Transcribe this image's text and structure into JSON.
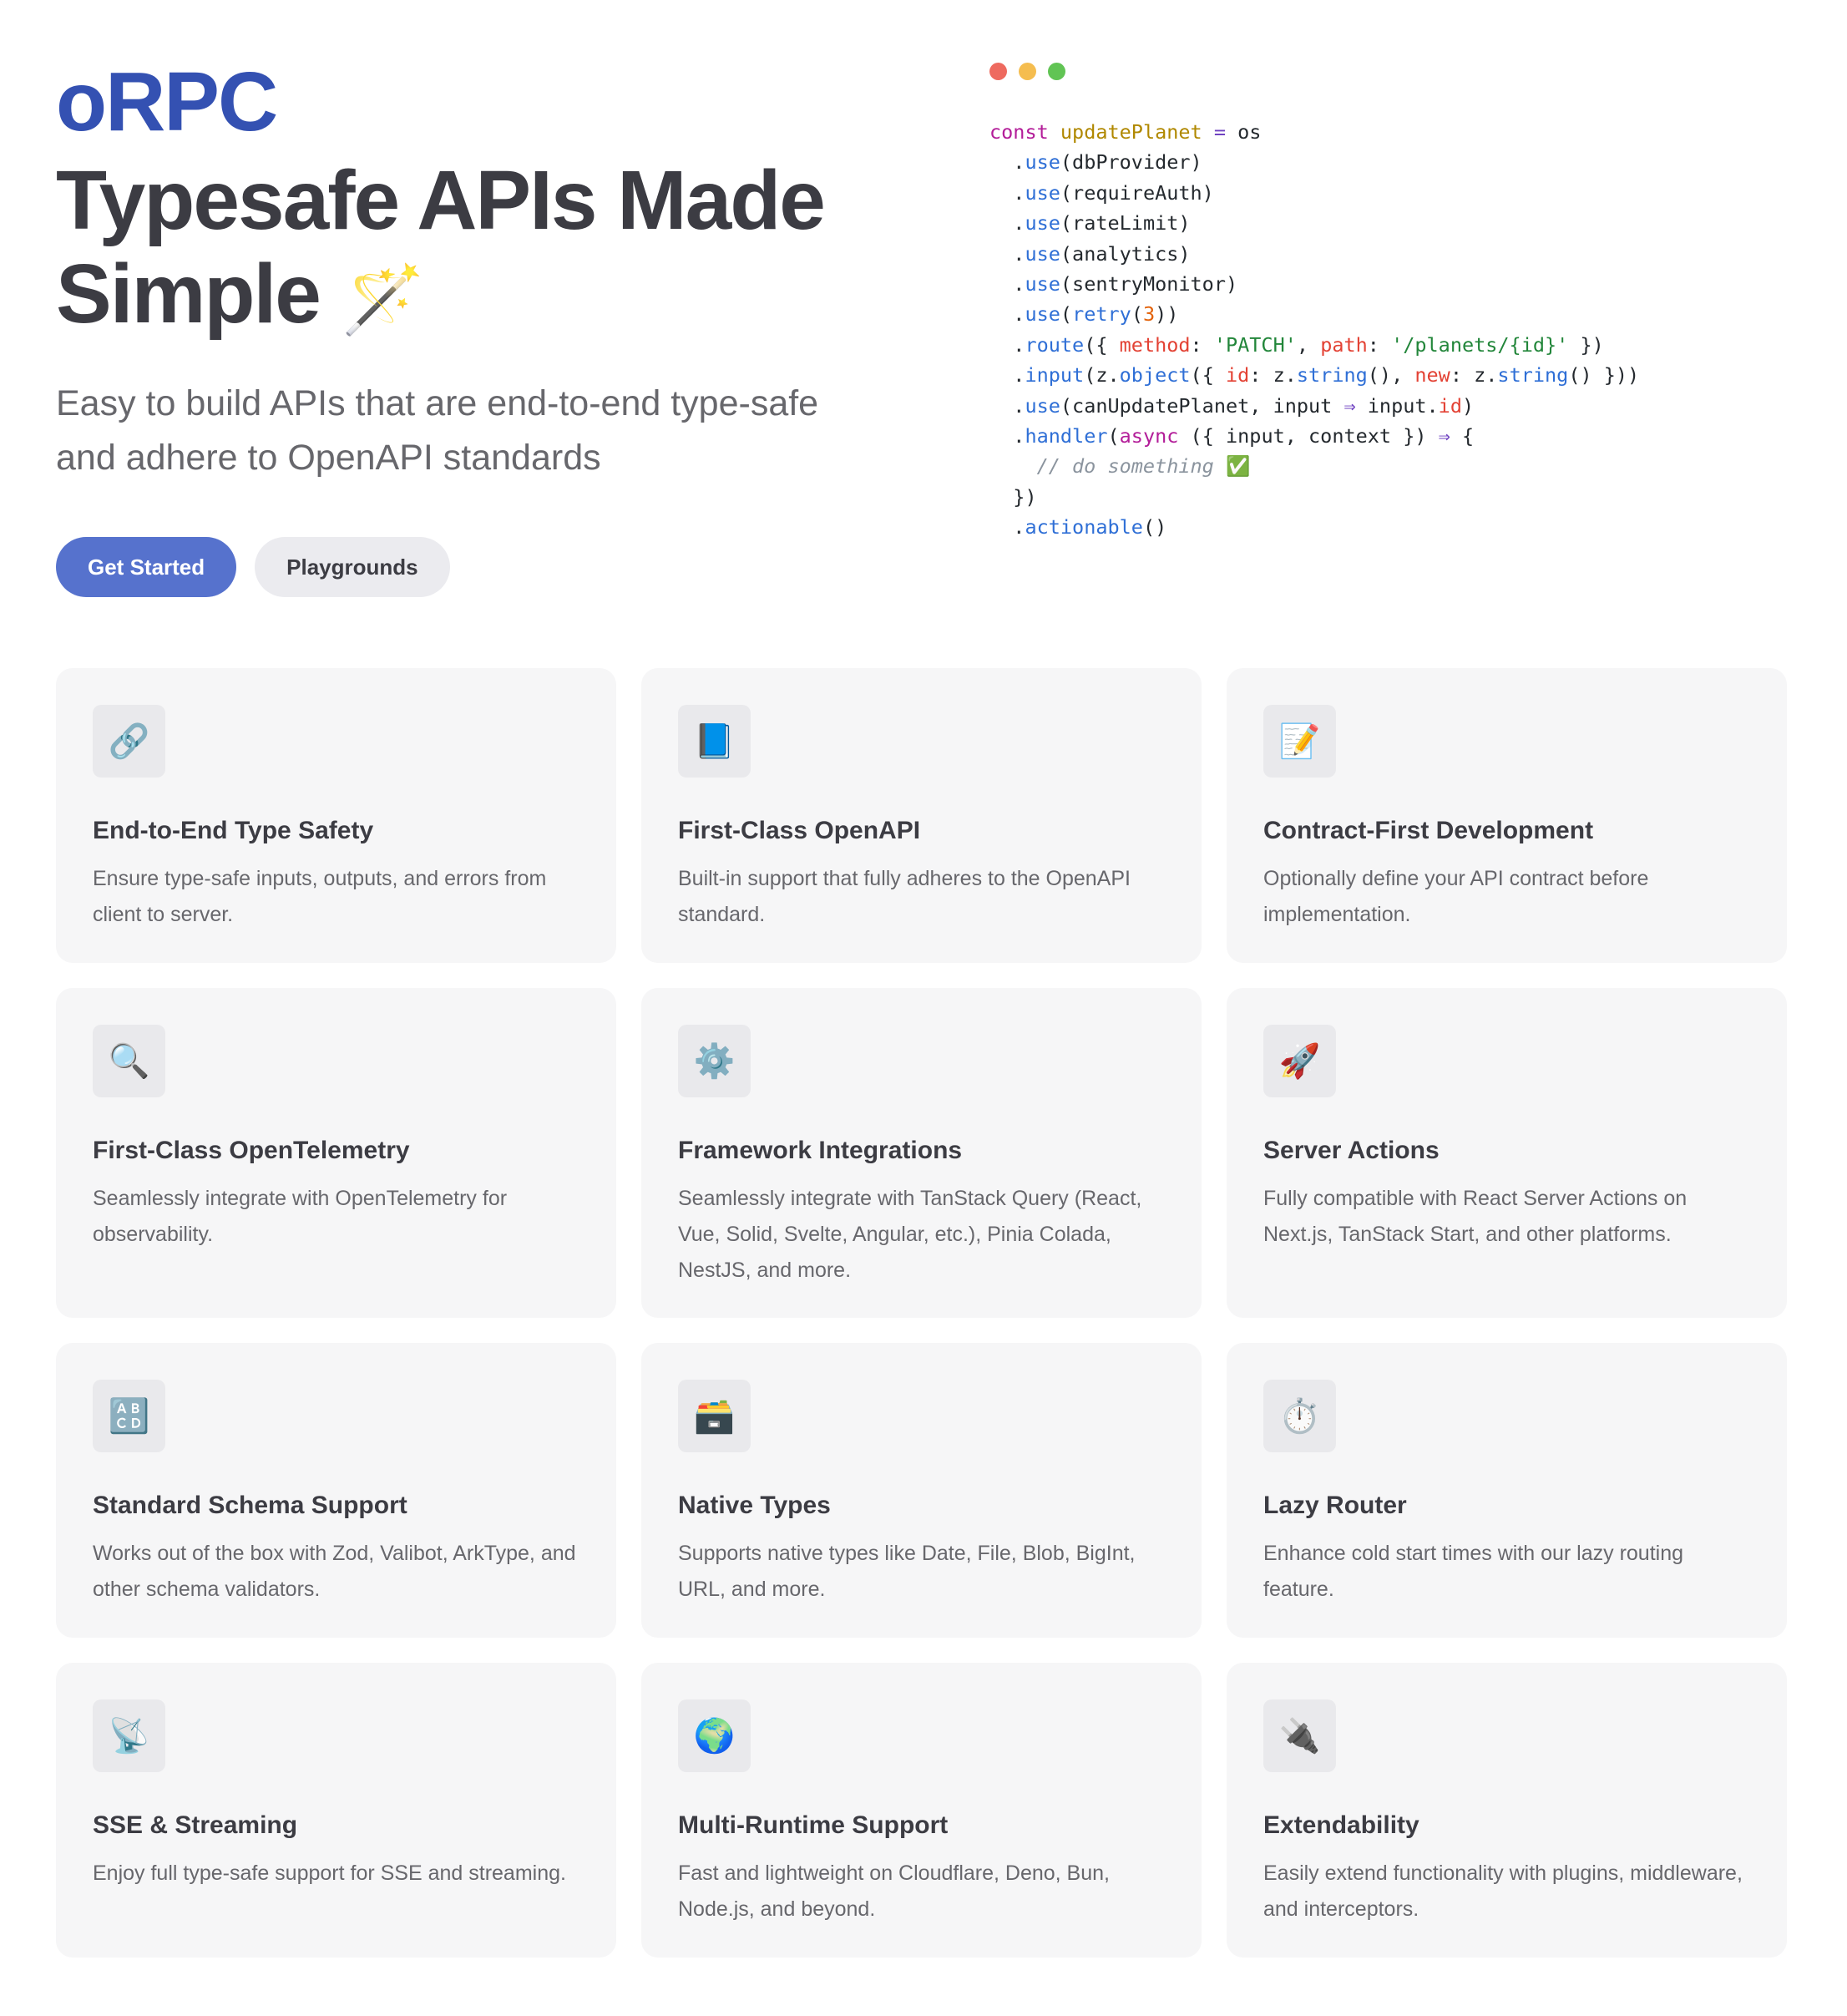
{
  "hero": {
    "brand": "oRPC",
    "headline_line1": "Typesafe APIs Made",
    "headline_line2": "Simple",
    "headline_emoji": "🪄",
    "tagline": "Easy to build APIs that are end-to-end type-safe and adhere to OpenAPI standards",
    "primary_button": "Get Started",
    "secondary_button": "Playgrounds"
  },
  "code_window": {
    "dot_colors": [
      "#ee6a5f",
      "#f5bd4f",
      "#61c454"
    ]
  },
  "features": [
    {
      "icon": "link-icon",
      "glyph": "🔗",
      "title": "End-to-End Type Safety",
      "desc": "Ensure type-safe inputs, outputs, and errors from client to server."
    },
    {
      "icon": "book-icon",
      "glyph": "📘",
      "title": "First-Class OpenAPI",
      "desc": "Built-in support that fully adheres to the OpenAPI standard."
    },
    {
      "icon": "memo-icon",
      "glyph": "📝",
      "title": "Contract-First Development",
      "desc": "Optionally define your API contract before implementation."
    },
    {
      "icon": "magnifier-icon",
      "glyph": "🔍",
      "title": "First-Class OpenTelemetry",
      "desc": "Seamlessly integrate with OpenTelemetry for observability."
    },
    {
      "icon": "gear-icon",
      "glyph": "⚙️",
      "title": "Framework Integrations",
      "desc": "Seamlessly integrate with TanStack Query (React, Vue, Solid, Svelte, Angular, etc.), Pinia Colada, NestJS, and more."
    },
    {
      "icon": "rocket-icon",
      "glyph": "🚀",
      "title": "Server Actions",
      "desc": "Fully compatible with React Server Actions on Next.js, TanStack Start, and other platforms."
    },
    {
      "icon": "abcd-icon",
      "glyph": "🔠",
      "title": "Standard Schema Support",
      "desc": "Works out of the box with Zod, Valibot, ArkType, and other schema validators."
    },
    {
      "icon": "card-file-box-icon",
      "glyph": "🗃️",
      "title": "Native Types",
      "desc": "Supports native types like Date, File, Blob, BigInt, URL, and more."
    },
    {
      "icon": "stopwatch-icon",
      "glyph": "⏱️",
      "title": "Lazy Router",
      "desc": "Enhance cold start times with our lazy routing feature."
    },
    {
      "icon": "satellite-dish-icon",
      "glyph": "📡",
      "title": "SSE & Streaming",
      "desc": "Enjoy full type-safe support for SSE and streaming."
    },
    {
      "icon": "globe-icon",
      "glyph": "🌍",
      "title": "Multi-Runtime Support",
      "desc": "Fast and lightweight on Cloudflare, Deno, Bun, Node.js, and beyond."
    },
    {
      "icon": "plug-icon",
      "glyph": "🔌",
      "title": "Extendability",
      "desc": "Easily extend functionality with plugins, middleware, and interceptors."
    }
  ]
}
